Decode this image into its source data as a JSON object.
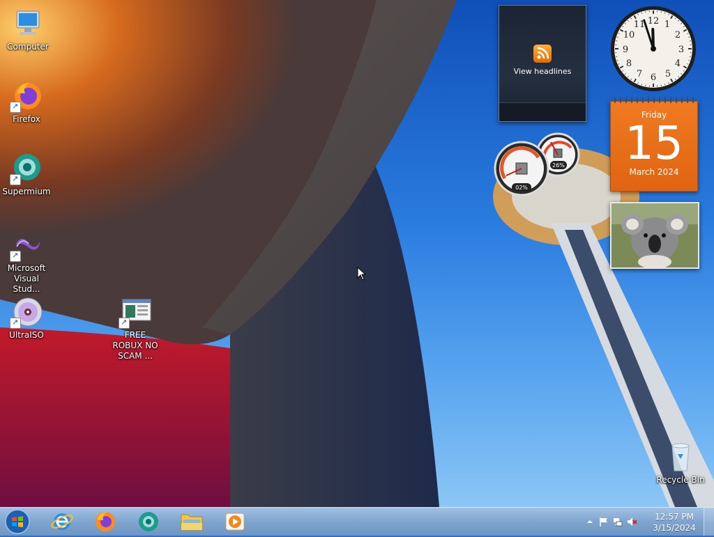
{
  "desktop": {
    "icons": [
      {
        "label": "Computer"
      },
      {
        "label": "Firefox"
      },
      {
        "label": "Supermium"
      },
      {
        "label": "Microsoft Visual Stud..."
      },
      {
        "label": "UltraISO"
      },
      {
        "label": "FREE ROBUX NO SCAM ..."
      },
      {
        "label": "Recycle Bin"
      }
    ]
  },
  "gadgets": {
    "feed": {
      "button_label": "View headlines"
    },
    "calendar": {
      "weekday": "Friday",
      "day": "15",
      "month_year": "March 2024"
    },
    "cpu_meter": {
      "cpu_percent": "02%",
      "memory_percent": "26%"
    },
    "clock": {
      "hour": 11,
      "minute": 57
    }
  },
  "taskbar": {
    "time": "12:57 PM",
    "date": "3/15/2024",
    "pinned": [
      "Internet Explorer",
      "Firefox",
      "Supermium",
      "Windows Explorer",
      "Windows Media Player"
    ]
  },
  "colors": {
    "calendar_orange": "#ec6f18",
    "taskbar_blue": "#88acd2",
    "rss_orange": "#f08a1a"
  }
}
